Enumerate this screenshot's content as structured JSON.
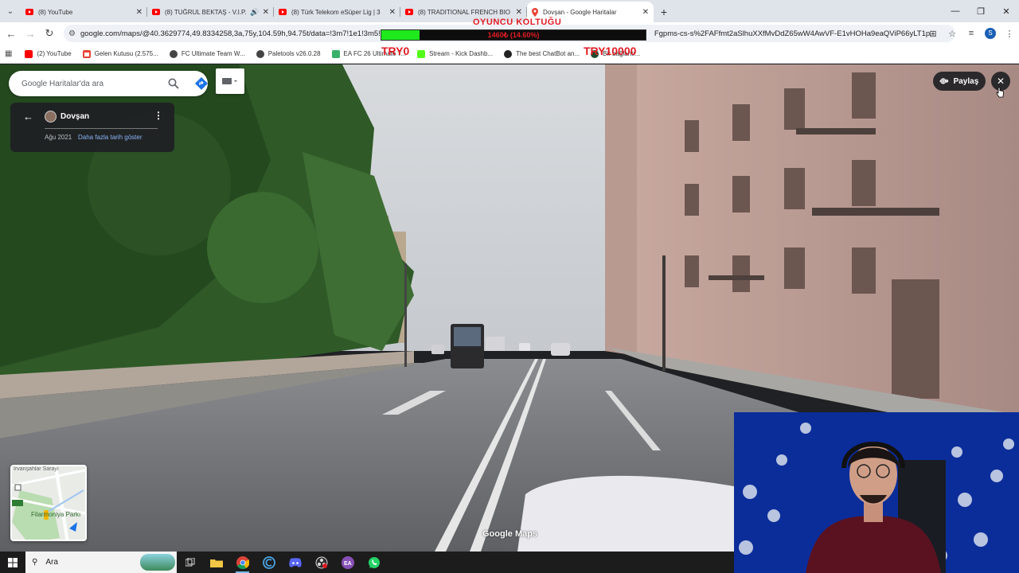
{
  "browser": {
    "tabs": [
      {
        "label": "(8) YouTube",
        "favicon": "youtube-icon",
        "audio": false,
        "active": false
      },
      {
        "label": "(8) TUĞRUL BEKTAŞ - V.I.P.",
        "favicon": "youtube-icon",
        "audio": true,
        "active": false
      },
      {
        "label": "(8) Türk Telekom eSüper Lig | 3",
        "favicon": "youtube-icon",
        "audio": false,
        "active": false
      },
      {
        "label": "(8) TRADITIONAL FRENCH BIO",
        "favicon": "youtube-icon",
        "audio": false,
        "active": false
      },
      {
        "label": "Dovşan - Google Haritalar",
        "favicon": "google-maps-icon",
        "audio": false,
        "active": true
      }
    ],
    "url": "google.com/maps/@40.3629774,49.8334258,3a,75y,104.59h,94.75t/data=!3m7!1e1!3m5!1s",
    "url_tail": "Fgpms-cs-s%2FAFfmt2aSlhuXXfMvDdZ65wW4AwVF-E1vHOHa9eaQViP66yLT1p...",
    "profile_initial": "S",
    "bookmarks": [
      {
        "label": "(2) YouTube",
        "color": "#ff0000"
      },
      {
        "label": "Gelen Kutusu (2.575...",
        "color": "#ea4335"
      },
      {
        "label": "FC Ultimate Team W...",
        "color": "#444444"
      },
      {
        "label": "Paletools v26.0.28",
        "color": "#444444"
      },
      {
        "label": "EA FC 26 Ultimate T...",
        "color": "#38b26a"
      },
      {
        "label": "Stream - Kick Dashb...",
        "color": "#53fc18"
      },
      {
        "label": "The best ChatBot an...",
        "color": "#222222"
      },
      {
        "label": "Bir bağlantı...",
        "color": "#1a4d2e"
      }
    ]
  },
  "stream_overlay": {
    "title": "OYUNCU KOLTUĞU",
    "value_text": "1460₺ (14.60%)",
    "progress": 0.146,
    "min_label": "TRY0",
    "max_label": "TRY10000",
    "fill_color": "#1de91d",
    "text_color": "#e01b24"
  },
  "maps": {
    "search_placeholder": "Google Haritalar'da ara",
    "place_name": "Dovşan",
    "capture_date": "Ağu 2021",
    "more_dates_label": "Daha fazla tarih göster",
    "share_label": "Paylaş",
    "minimap_label_top": "İrvanşahlar Sarayı",
    "minimap_label_park": "Filarmoniya Parkı",
    "watermark": "Google Maps"
  },
  "taskbar": {
    "search_placeholder": "Ara",
    "items": [
      "task-view-icon",
      "file-explorer-icon",
      "chrome-icon",
      "ccleaner-icon",
      "discord-icon",
      "obs-icon",
      "ea-app-icon",
      "whatsapp-icon"
    ]
  }
}
